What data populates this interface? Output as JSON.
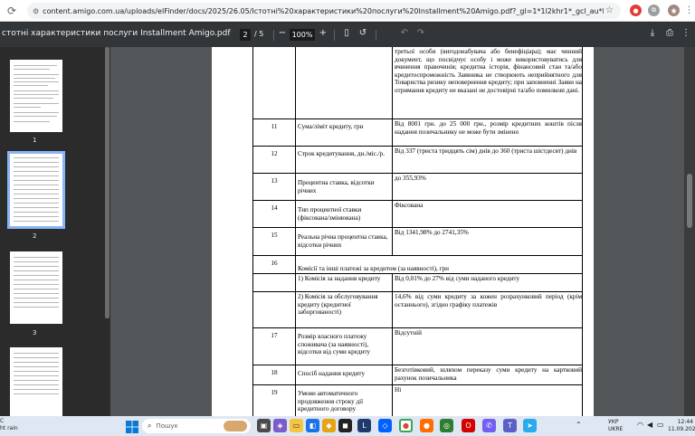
{
  "browser": {
    "url": "content.amigo.com.ua/uploads/elFinder/docs/2025/26.05/Істотні%20характеристики%20послуги%20Installment%20Amigo.pdf?_gl=1*1l2khr1*_gcl_au*MTQ5NDA3MTIxMi4xNzU3NTE0..."
  },
  "pdf_toolbar": {
    "title": "стотні характеристики послуги Installment Amigo.pdf",
    "current_page": "2",
    "total_pages": "/ 5",
    "zoom": "100%",
    "zoom_out": "−",
    "zoom_in": "+"
  },
  "thumbnails": [
    {
      "number": "1"
    },
    {
      "number": "2"
    },
    {
      "number": "3"
    }
  ],
  "table": {
    "intro": "третьої особи (вигодонабувача або бенефіціара); має чинний документ, що посвідчує особу і може використовуватись для вчинення правочинів; кредитна історія, фінансовий стан та/або кредитоспроможність Заявника не створюють неприйнятного для Товариства ризику неповернення кредиту; при заповненні Заяви на отримання кредиту не вказані не достовірні та/або помилкові дані.",
    "rows": [
      {
        "num": "11",
        "name": "Сума/ліміт кредиту, грн",
        "value": "Від 8001 грн. до 25 000 грн., розмір кредитних коштів після надання позичальнику не може бути змінено"
      },
      {
        "num": "12",
        "name": "Строк кредитування, дн./міс./р.",
        "value": "Від 337 (триста тридцять сім) днів до 360 (триста шістдесят) днів"
      },
      {
        "num": "13",
        "name": "Процентна ставка, відсотки річних",
        "value": "до 355,93%"
      },
      {
        "num": "14",
        "name": "Тип процентної ставки (фіксована/змінювана)",
        "value": "Фіксована"
      },
      {
        "num": "15",
        "name": "Реальна річна процентна ставка, відсотки річних",
        "value": "Від 1341,98% до 2741,35%"
      },
      {
        "num": "16",
        "name": "Комісії та інші платежі за кредитом (за наявності), грн",
        "value": ""
      },
      {
        "num": "",
        "name": "1) Комісія за надання кредиту",
        "value": "Від 0,01% до 27%  від суми наданого кредиту"
      },
      {
        "num": "",
        "name": "2) Комісія за обслуговування кредиту (кредитної заборгованості)",
        "value": "14,6% від суми кредиту за кожен розрахунковий період (крім останнього), згідно графіку платежів"
      },
      {
        "num": "17",
        "name": "Розмір власного платежу споживача (за наявності), відсотки від суми кредиту",
        "value": "Відсутній"
      },
      {
        "num": "18",
        "name": "Спосіб надання кредиту",
        "value": "Безготівковий, шляхом переказу суми кредиту на картковий рахунок позичальника"
      },
      {
        "num": "19",
        "name": "Умови автоматичного продовження строку дії кредитного договору",
        "value": "Ні"
      }
    ]
  },
  "taskbar": {
    "weather_line1": "C",
    "weather_line2": "ht rain",
    "search_placeholder": "Пошук",
    "lang_line1": "УКР",
    "lang_line2": "UKRE",
    "time": "12:44",
    "date": "11.09.2025"
  }
}
